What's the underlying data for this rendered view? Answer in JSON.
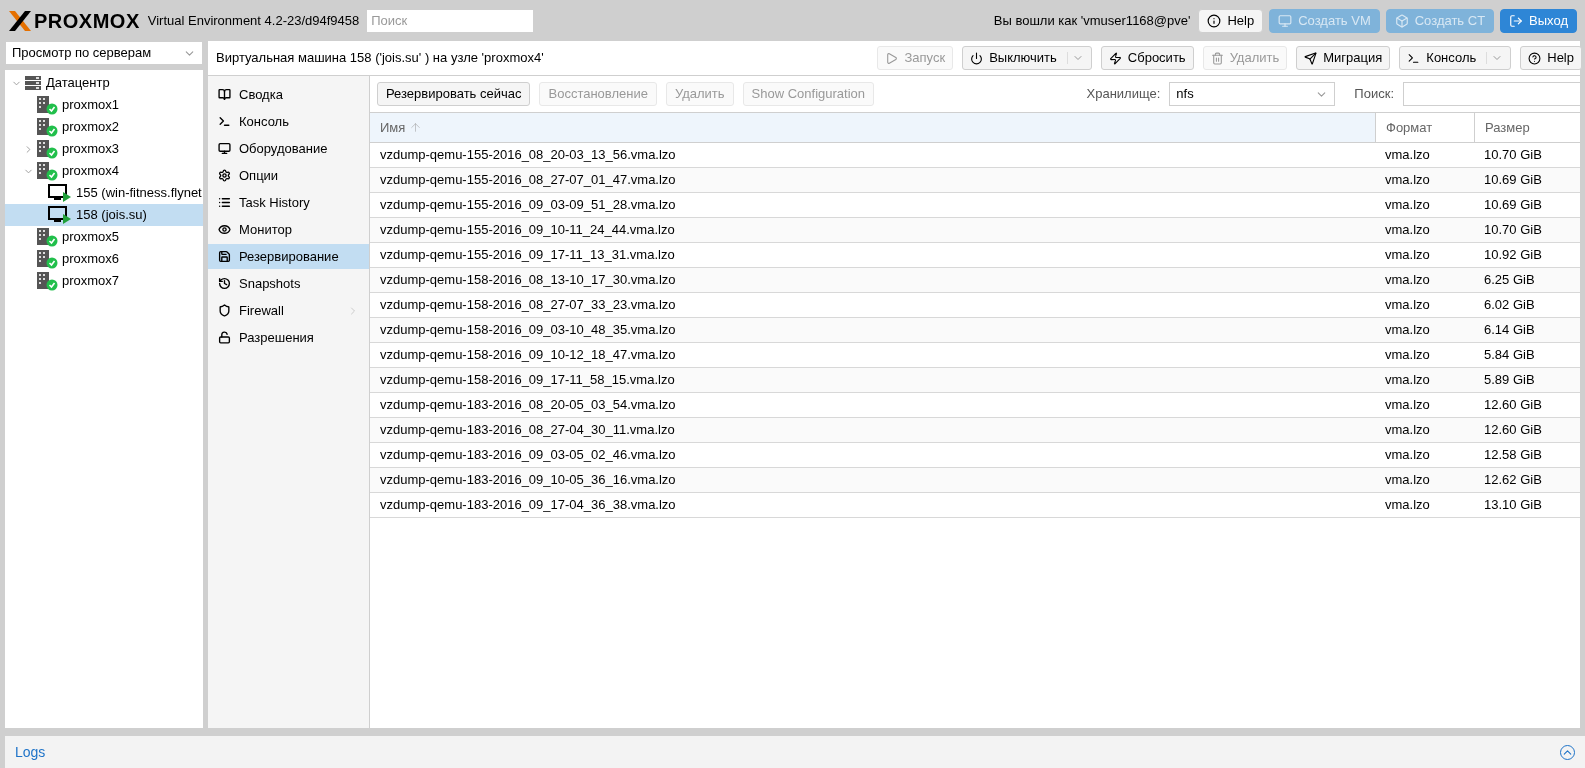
{
  "header": {
    "logo": "PROXMOX",
    "version": "Virtual Environment 4.2-23/d94f9458",
    "search": {
      "placeholder": "Поиск"
    },
    "user": "Вы вошли как 'vmuser1168@pve'",
    "buttons": [
      {
        "label": "Help",
        "kind": "help",
        "disabled": false
      },
      {
        "label": "Создать VM",
        "kind": "vm",
        "disabled": true
      },
      {
        "label": "Создать CT",
        "kind": "ct",
        "disabled": true
      },
      {
        "label": "Выход",
        "kind": "logout",
        "disabled": false
      }
    ]
  },
  "view_select": {
    "value": "Просмотр по серверам"
  },
  "tree": [
    {
      "label": "Датацентр",
      "kind": "datacenter",
      "selected": false,
      "expanded": true,
      "children": [
        {
          "label": "proxmox1",
          "kind": "node",
          "selected": false
        },
        {
          "label": "proxmox2",
          "kind": "node",
          "selected": false
        },
        {
          "label": "proxmox3",
          "kind": "node",
          "selected": false,
          "expanded": false
        },
        {
          "label": "proxmox4",
          "kind": "node",
          "selected": false,
          "expanded": true,
          "children": [
            {
              "label": "155 (win-fitness.flynet",
              "kind": "vm",
              "selected": false
            },
            {
              "label": "158 (jois.su)",
              "kind": "vm",
              "selected": true
            }
          ]
        },
        {
          "label": "proxmox5",
          "kind": "node",
          "selected": false
        },
        {
          "label": "proxmox6",
          "kind": "node",
          "selected": false
        },
        {
          "label": "proxmox7",
          "kind": "node",
          "selected": false
        }
      ]
    }
  ],
  "panel": {
    "title": "Виртуальная машина 158 ('jois.su' ) на узле 'proxmox4'",
    "toolbar": [
      {
        "label": "Запуск",
        "kind": "play",
        "disabled": true,
        "split": false
      },
      {
        "label": "Выключить",
        "kind": "power",
        "disabled": false,
        "split": true
      },
      {
        "label": "Сбросить",
        "kind": "bolt",
        "disabled": false,
        "split": false
      },
      {
        "label": "Удалить",
        "kind": "trash",
        "disabled": true,
        "split": false
      },
      {
        "label": "Миграция",
        "kind": "send",
        "disabled": false,
        "split": false
      },
      {
        "label": "Консоль",
        "kind": "terminal",
        "disabled": false,
        "split": true
      },
      {
        "label": "Help",
        "kind": "help",
        "disabled": false,
        "split": false
      }
    ]
  },
  "nav": [
    {
      "label": "Сводка",
      "selected": false,
      "submenu": false
    },
    {
      "label": "Консоль",
      "selected": false,
      "submenu": false
    },
    {
      "label": "Оборудование",
      "selected": false,
      "submenu": false
    },
    {
      "label": "Опции",
      "selected": false,
      "submenu": false
    },
    {
      "label": "Task History",
      "selected": false,
      "submenu": false
    },
    {
      "label": "Монитор",
      "selected": false,
      "submenu": false
    },
    {
      "label": "Резервирование",
      "selected": true,
      "submenu": false
    },
    {
      "label": "Snapshots",
      "selected": false,
      "submenu": false
    },
    {
      "label": "Firewall",
      "selected": false,
      "submenu": true
    },
    {
      "label": "Разрешения",
      "selected": false,
      "submenu": false
    }
  ],
  "backup_toolbar": {
    "buttons": [
      {
        "label": "Резервировать сейчас",
        "disabled": false
      },
      {
        "label": "Восстановление",
        "disabled": true
      },
      {
        "label": "Удалить",
        "disabled": true
      },
      {
        "label": "Show Configuration",
        "disabled": true
      }
    ],
    "storage_label": "Хранилище:",
    "storage_value": "nfs",
    "search_label": "Поиск:"
  },
  "table": {
    "columns": [
      {
        "label": "Имя",
        "sorted": true
      },
      {
        "label": "Формат",
        "sorted": false
      },
      {
        "label": "Размер",
        "sorted": false
      }
    ],
    "rows": [
      [
        "vzdump-qemu-155-2016_08_20-03_13_56.vma.lzo",
        "vma.lzo",
        "10.70 GiB"
      ],
      [
        "vzdump-qemu-155-2016_08_27-07_01_47.vma.lzo",
        "vma.lzo",
        "10.69 GiB"
      ],
      [
        "vzdump-qemu-155-2016_09_03-09_51_28.vma.lzo",
        "vma.lzo",
        "10.69 GiB"
      ],
      [
        "vzdump-qemu-155-2016_09_10-11_24_44.vma.lzo",
        "vma.lzo",
        "10.70 GiB"
      ],
      [
        "vzdump-qemu-155-2016_09_17-11_13_31.vma.lzo",
        "vma.lzo",
        "10.92 GiB"
      ],
      [
        "vzdump-qemu-158-2016_08_13-10_17_30.vma.lzo",
        "vma.lzo",
        "6.25 GiB"
      ],
      [
        "vzdump-qemu-158-2016_08_27-07_33_23.vma.lzo",
        "vma.lzo",
        "6.02 GiB"
      ],
      [
        "vzdump-qemu-158-2016_09_03-10_48_35.vma.lzo",
        "vma.lzo",
        "6.14 GiB"
      ],
      [
        "vzdump-qemu-158-2016_09_10-12_18_47.vma.lzo",
        "vma.lzo",
        "5.84 GiB"
      ],
      [
        "vzdump-qemu-158-2016_09_17-11_58_15.vma.lzo",
        "vma.lzo",
        "5.89 GiB"
      ],
      [
        "vzdump-qemu-183-2016_08_20-05_03_54.vma.lzo",
        "vma.lzo",
        "12.60 GiB"
      ],
      [
        "vzdump-qemu-183-2016_08_27-04_30_11.vma.lzo",
        "vma.lzo",
        "12.60 GiB"
      ],
      [
        "vzdump-qemu-183-2016_09_03-05_02_46.vma.lzo",
        "vma.lzo",
        "12.58 GiB"
      ],
      [
        "vzdump-qemu-183-2016_09_10-05_36_16.vma.lzo",
        "vma.lzo",
        "12.62 GiB"
      ],
      [
        "vzdump-qemu-183-2016_09_17-04_36_38.vma.lzo",
        "vma.lzo",
        "13.10 GiB"
      ]
    ]
  },
  "logs": {
    "title": "Logs"
  }
}
